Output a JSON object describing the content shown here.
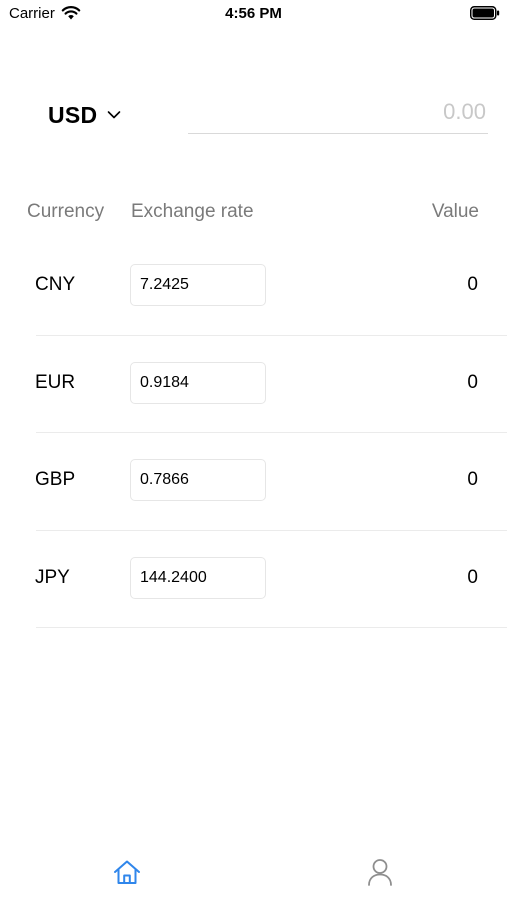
{
  "status_bar": {
    "carrier": "Carrier",
    "time": "4:56 PM"
  },
  "converter": {
    "base_currency": "USD",
    "amount_placeholder": "0.00",
    "amount_value": ""
  },
  "table": {
    "headers": {
      "currency": "Currency",
      "rate": "Exchange rate",
      "value": "Value"
    },
    "rows": [
      {
        "code": "CNY",
        "rate": "7.2425",
        "value": "0"
      },
      {
        "code": "EUR",
        "rate": "0.9184",
        "value": "0"
      },
      {
        "code": "GBP",
        "rate": "0.7866",
        "value": "0"
      },
      {
        "code": "JPY",
        "rate": "144.2400",
        "value": "0"
      }
    ]
  },
  "tab_bar": {
    "tabs": [
      {
        "icon": "home-icon",
        "active": true
      },
      {
        "icon": "profile-icon",
        "active": false
      }
    ]
  },
  "colors": {
    "accent": "#2f86eb",
    "inactive": "#8e8e8e",
    "header_text": "#7a7a7a",
    "placeholder": "#c8c8c8"
  }
}
